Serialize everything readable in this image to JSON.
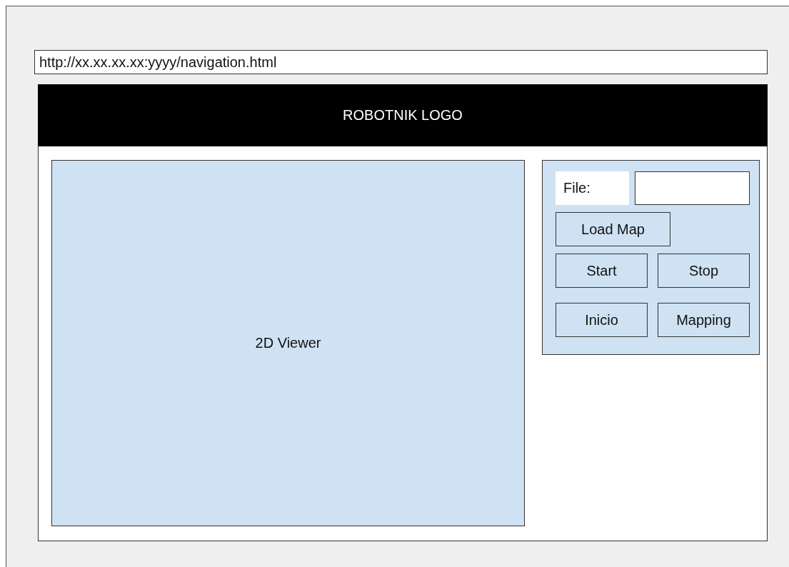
{
  "address_bar": {
    "url": "http://xx.xx.xx.xx:yyyy/navigation.html"
  },
  "header": {
    "logo": "ROBOTNIK LOGO"
  },
  "viewer": {
    "label": "2D Viewer"
  },
  "controls": {
    "file_label": "File:",
    "button_rows": [
      [
        "Load Map"
      ],
      [
        "Start",
        "Stop"
      ],
      [
        "Inicio",
        "Mapping"
      ]
    ]
  }
}
